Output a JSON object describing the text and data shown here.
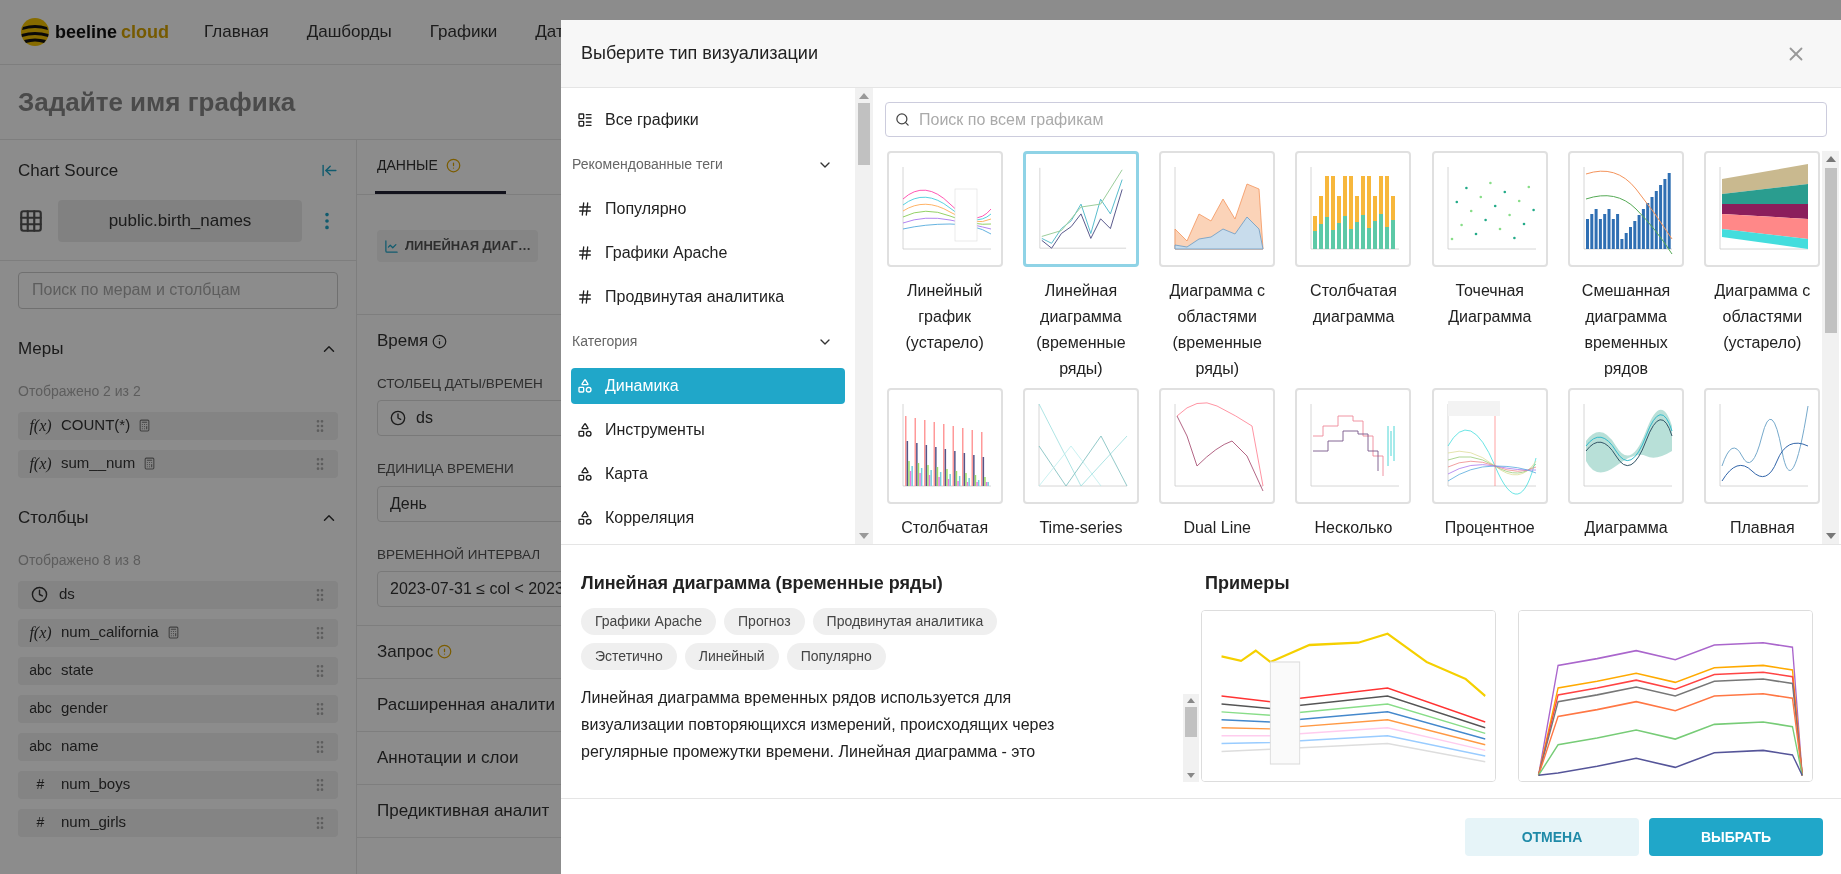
{
  "app_header": {
    "logo": {
      "name": "beeline",
      "accent": "cloud"
    },
    "nav": [
      "Главная",
      "Дашборды",
      "Графики",
      "Дат"
    ]
  },
  "chart_title": "Задайте имя графика",
  "source_panel": {
    "title": "Chart Source",
    "dataset": "public.birth_names",
    "search": {
      "placeholder": "Поиск по мерам и столбцам"
    },
    "sections": [
      {
        "title": "Меры",
        "expanded": true,
        "count": "Отображено 2 из 2",
        "items": [
          {
            "kind": "metric",
            "type_label": "f(x)",
            "name": "COUNT(*)",
            "calculated": true
          },
          {
            "kind": "metric",
            "type_label": "f(x)",
            "name": "sum__num",
            "calculated": true
          }
        ]
      },
      {
        "title": "Столбцы",
        "expanded": true,
        "count": "Отображено 8 из 8",
        "items": [
          {
            "kind": "time",
            "name": "ds",
            "calculated": false
          },
          {
            "kind": "metric",
            "type_label": "f(x)",
            "name": "num_california",
            "calculated": true
          },
          {
            "kind": "text",
            "type_label": "abc",
            "name": "state",
            "calculated": false
          },
          {
            "kind": "text",
            "type_label": "abc",
            "name": "gender",
            "calculated": false
          },
          {
            "kind": "text",
            "type_label": "abc",
            "name": "name",
            "calculated": false
          },
          {
            "kind": "number",
            "type_label": "#",
            "name": "num_boys",
            "calculated": false
          },
          {
            "kind": "number",
            "type_label": "#",
            "name": "num_girls",
            "calculated": false
          }
        ]
      }
    ]
  },
  "control_panel": {
    "tabs": [
      {
        "label": "ДАННЫЕ",
        "selected": true,
        "warning": true
      }
    ],
    "viz_button": "ЛИНЕЙНАЯ ДИАГ…",
    "time_section": {
      "title": "Время",
      "fields": [
        {
          "kind": "column",
          "label": "СТОЛБЕЦ ДАТЫ/ВРЕМЕН",
          "value": "ds"
        },
        {
          "kind": "select",
          "label": "ЕДИНИЦА ВРЕМЕНИ",
          "value": "День"
        },
        {
          "kind": "range",
          "label": "ВРЕМЕННОЙ ИНТЕРВАЛ",
          "value": "2023-07-31 ≤ col < 2023"
        }
      ]
    },
    "sections": [
      {
        "title": "Запрос",
        "warning": true
      },
      {
        "title": "Расширенная аналити",
        "warning": false
      },
      {
        "title": "Аннотации и слои",
        "warning": false
      },
      {
        "title": "Предиктивная аналит",
        "warning": false
      }
    ]
  },
  "modal": {
    "title": "Выберите тип визуализации",
    "sidebar": [
      {
        "kind": "item",
        "label": "Все графики",
        "selected": false
      },
      {
        "kind": "group",
        "label": "Рекомендованные теги",
        "expanded": true
      },
      {
        "kind": "tag",
        "label": "Популярно",
        "selected": false
      },
      {
        "kind": "tag",
        "label": "Графики Apache",
        "selected": false
      },
      {
        "kind": "tag",
        "label": "Продвинутая аналитика",
        "selected": false
      },
      {
        "kind": "group",
        "label": "Категория",
        "expanded": true
      },
      {
        "kind": "category",
        "label": "Динамика",
        "selected": true
      },
      {
        "kind": "category",
        "label": "Инструменты",
        "selected": false
      },
      {
        "kind": "category",
        "label": "Карта",
        "selected": false
      },
      {
        "kind": "category",
        "label": "Корреляция",
        "selected": false
      }
    ],
    "search": {
      "placeholder": "Поиск по всем графикам"
    },
    "charts": [
      {
        "label": "Линейный график (устарело)",
        "selected": false
      },
      {
        "label": "Линейная диаграмма (временные ряды)",
        "selected": true
      },
      {
        "label": "Диаграмма с областями (временные ряды)",
        "selected": false
      },
      {
        "label": "Столбчатая диаграмма",
        "selected": false
      },
      {
        "label": "Точечная Диаграмма",
        "selected": false
      },
      {
        "label": "Смешанная диаграмма временных рядов",
        "selected": false
      },
      {
        "label": "Диаграмма с областями (устарело)",
        "selected": false
      },
      {
        "label": "Столбчатая",
        "selected": false
      },
      {
        "label": "Time-series",
        "selected": false
      },
      {
        "label": "Dual Line",
        "selected": false
      },
      {
        "label": "Несколько",
        "selected": false
      },
      {
        "label": "Процентное",
        "selected": false
      },
      {
        "label": "Диаграмма",
        "selected": false
      },
      {
        "label": "Плавная",
        "selected": false
      }
    ],
    "details": {
      "title": "Линейная диаграмма (временные ряды)",
      "tags": [
        "Графики Apache",
        "Прогноз",
        "Продвинутая аналитика",
        "Эстетично",
        "Линейный",
        "Популярно"
      ],
      "description": "Линейная диаграмма временных рядов используется для визуализации повторяющихся измерений, происходящих через регулярные промежутки времени. Линейная диаграмма - это",
      "examples_title": "Примеры",
      "examples": [
        {
          "kind": "picture"
        },
        {
          "kind": "picture"
        }
      ]
    },
    "buttons": [
      {
        "kind": "secondary",
        "label": "ОТМЕНА"
      },
      {
        "kind": "primary",
        "label": "ВЫБРАТЬ"
      }
    ]
  }
}
